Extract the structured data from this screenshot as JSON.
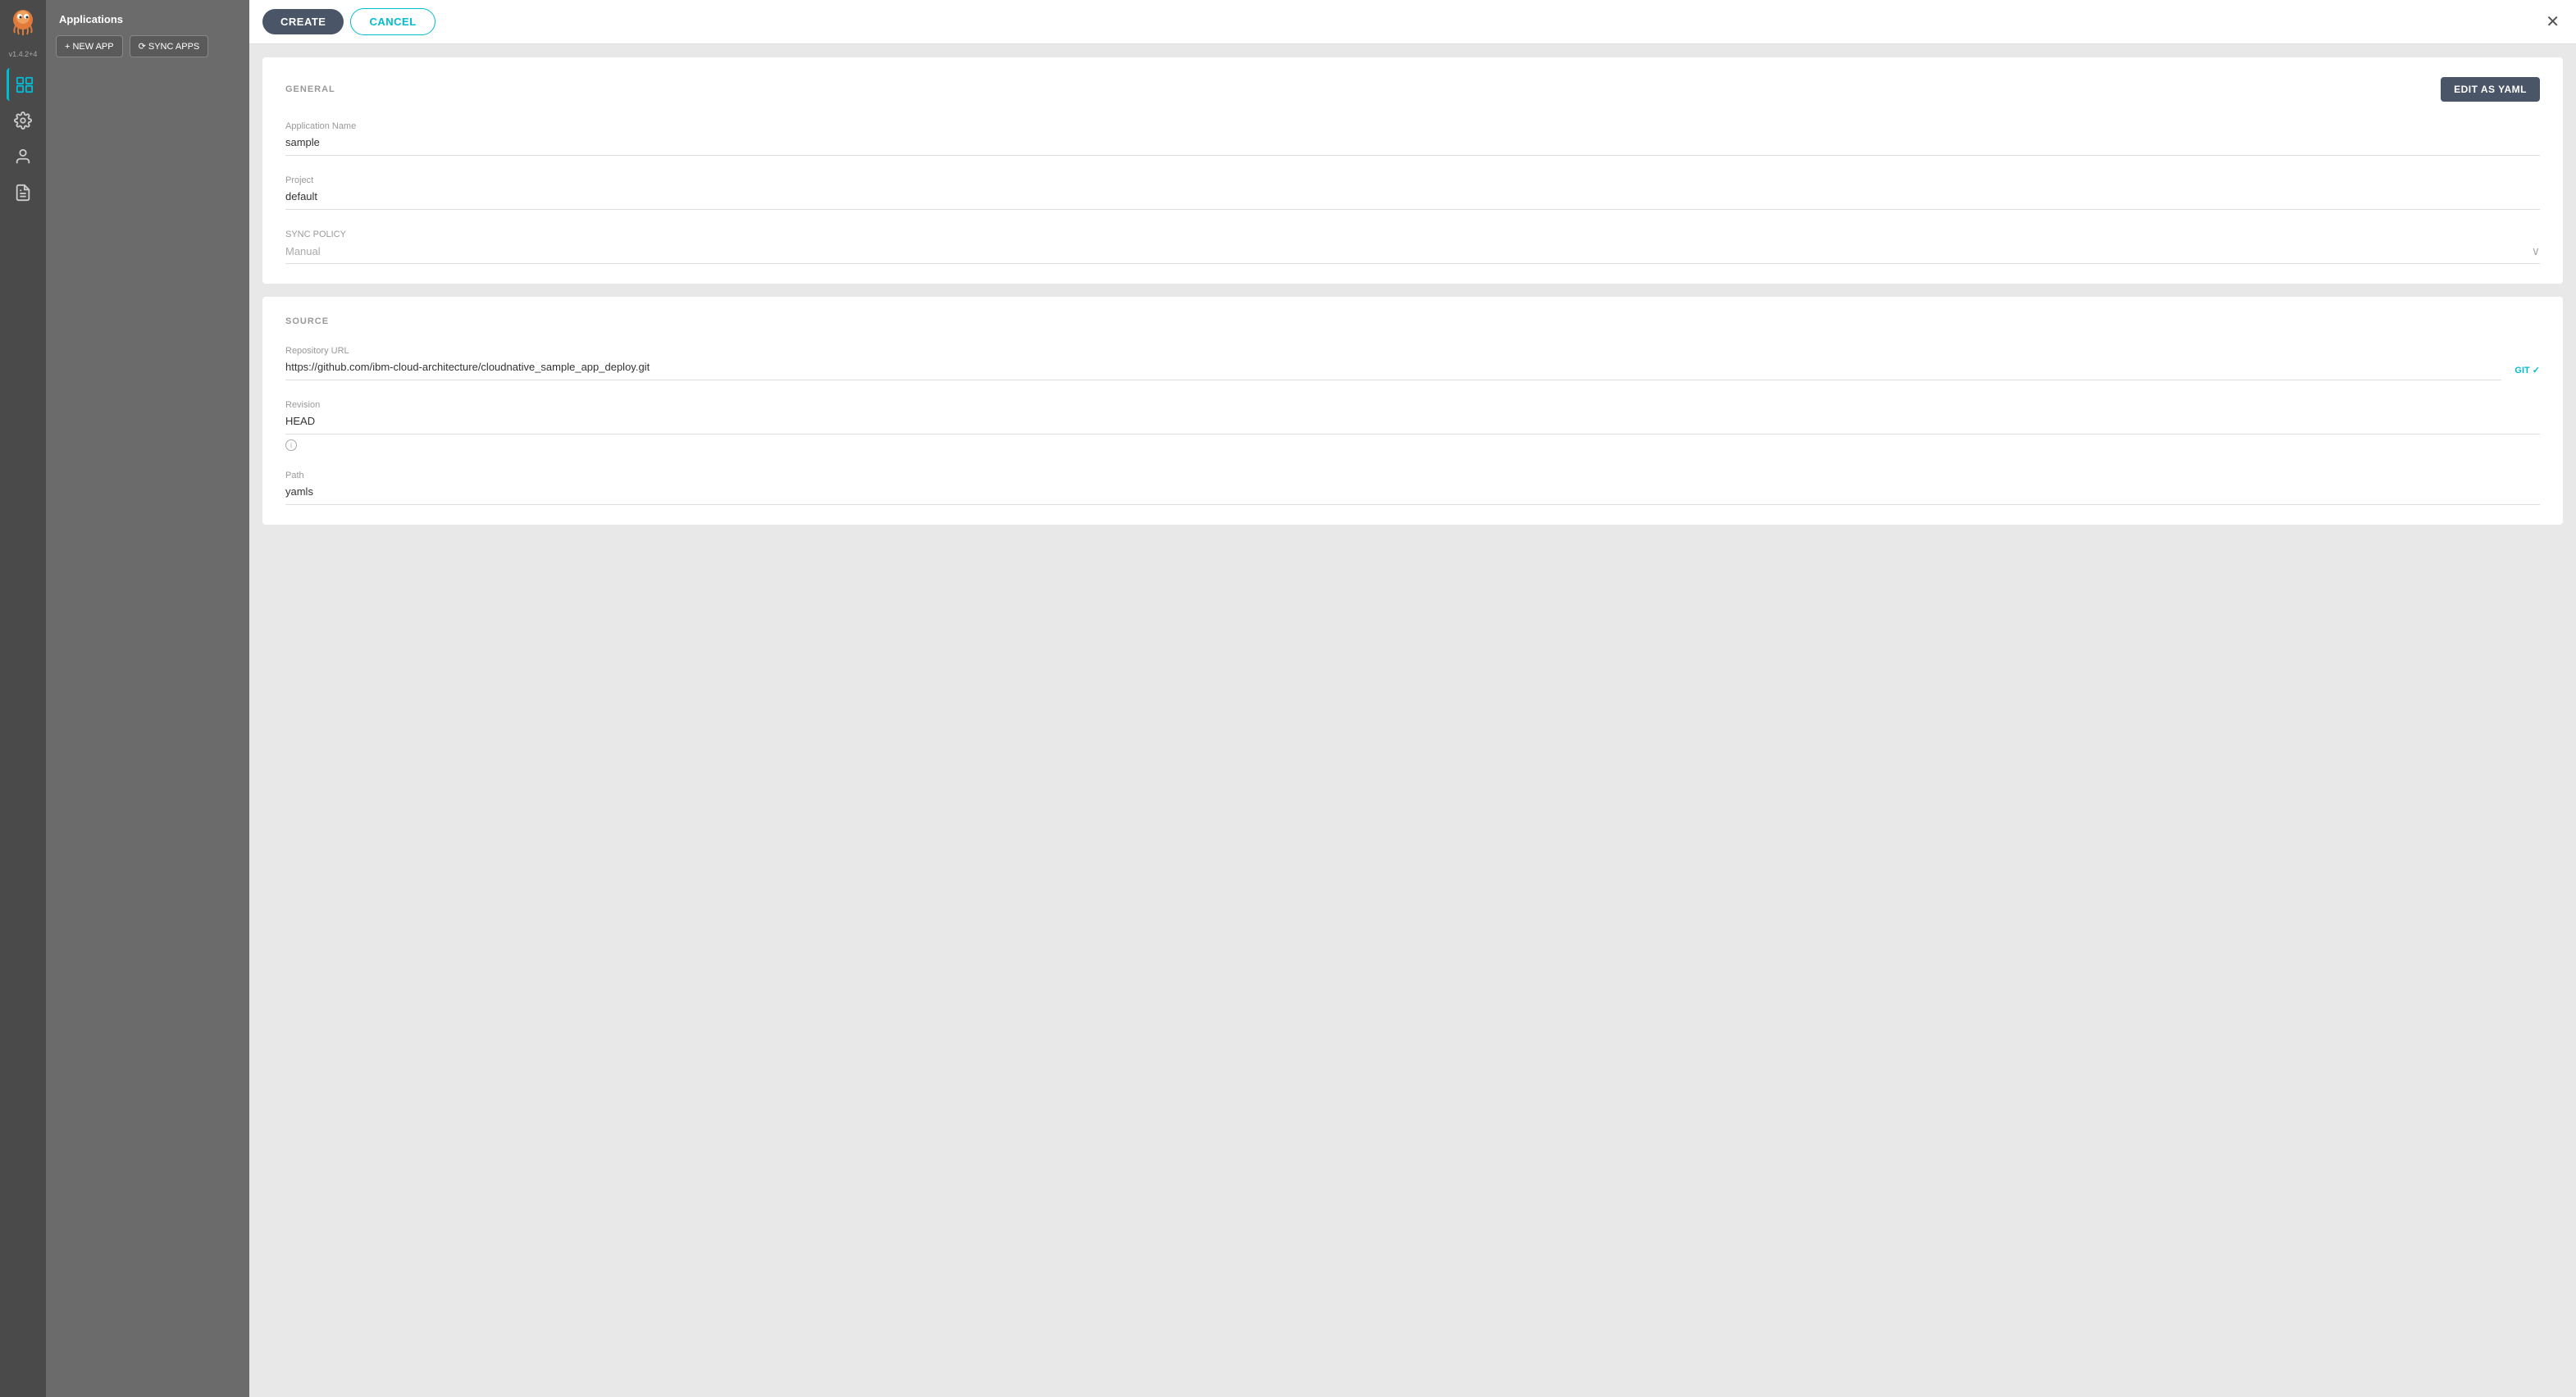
{
  "sidebar": {
    "version": "v1.4.2+4",
    "items": [
      {
        "name": "apps-icon",
        "label": "Applications",
        "active": true
      },
      {
        "name": "settings-icon",
        "label": "Settings",
        "active": false
      },
      {
        "name": "user-icon",
        "label": "User",
        "active": false
      },
      {
        "name": "logs-icon",
        "label": "Logs",
        "active": false
      }
    ]
  },
  "left_panel": {
    "title": "Applications",
    "new_app_label": "+ NEW APP",
    "sync_apps_label": "⟳ SYNC APPS"
  },
  "toolbar": {
    "create_label": "CREATE",
    "cancel_label": "CANCEL",
    "close_label": "✕"
  },
  "general_section": {
    "title": "GENERAL",
    "edit_yaml_label": "EDIT AS YAML",
    "application_name_label": "Application Name",
    "application_name_value": "sample",
    "project_label": "Project",
    "project_value": "default",
    "sync_policy_label": "SYNC POLICY",
    "sync_policy_placeholder": "Manual"
  },
  "source_section": {
    "title": "SOURCE",
    "repository_url_label": "Repository URL",
    "repository_url_value": "https://github.com/ibm-cloud-architecture/cloudnative_sample_app_deploy.git",
    "git_badge": "GIT ✓",
    "revision_label": "Revision",
    "revision_value": "HEAD",
    "path_label": "Path",
    "path_value": "yamls"
  }
}
